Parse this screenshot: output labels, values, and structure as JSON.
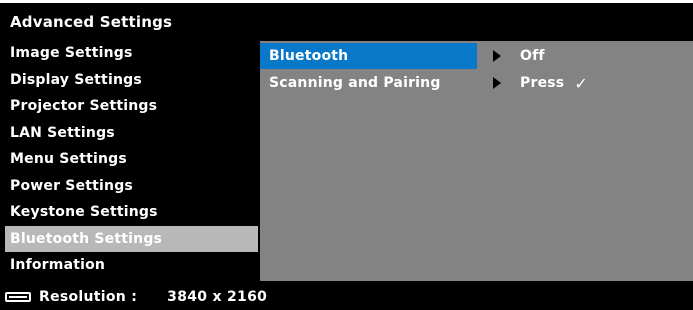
{
  "header": {
    "title": "Advanced Settings"
  },
  "menu": {
    "items": [
      {
        "label": "Image Settings"
      },
      {
        "label": "Display Settings"
      },
      {
        "label": "Projector Settings"
      },
      {
        "label": "LAN Settings"
      },
      {
        "label": "Menu Settings"
      },
      {
        "label": "Power Settings"
      },
      {
        "label": "Keystone Settings"
      },
      {
        "label": "Bluetooth Settings"
      },
      {
        "label": "Information"
      }
    ],
    "selected_index": 7
  },
  "panel": {
    "rows": [
      {
        "label": "Bluetooth",
        "value": "Off"
      },
      {
        "label": "Scanning and Pairing",
        "value": "Press",
        "check": "✓"
      }
    ]
  },
  "status": {
    "resolution_label": "Resolution :",
    "resolution_value": "3840 x 2160"
  },
  "colors": {
    "background": "#000000",
    "panel": "#838383",
    "selected_item": "#b8b8b8",
    "highlight": "#0a78c8"
  },
  "icons": {
    "resolution": "monitor-icon",
    "submenu": "triangle-right-icon",
    "confirm": "check-icon"
  }
}
